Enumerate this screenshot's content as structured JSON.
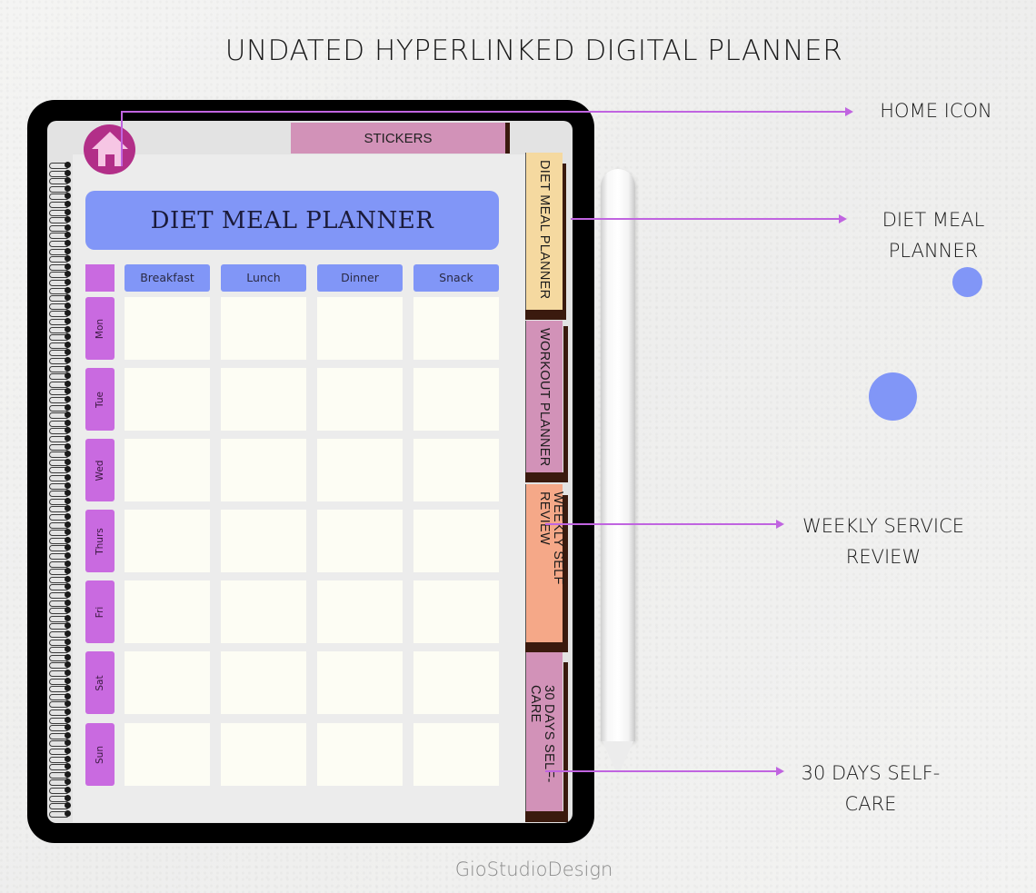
{
  "title": "UNDATED HYPERLINKED DIGITAL PLANNER",
  "brand": "GioStudioDesign",
  "colors": {
    "accent_blue": "#8196f7",
    "accent_purple": "#c96ae0",
    "home_magenta": "#b22f88",
    "callout_line": "#c064e0",
    "meal_cell": "#fdfdf4",
    "tab_diet": "#f5d9a0",
    "tab_workout": "#d292b8",
    "tab_weekly": "#f5a888",
    "tab_selfcare": "#d292b8"
  },
  "planner": {
    "home_icon": "home-icon",
    "stickers_label": "STICKERS",
    "heading": "DIET MEAL PLANNER",
    "columns": [
      "Breakfast",
      "Lunch",
      "Dinner",
      "Snack"
    ],
    "days": [
      "Mon",
      "Tue",
      "Wed",
      "Thurs",
      "Fri",
      "Sat",
      "Sun"
    ],
    "side_tabs": [
      {
        "label": "DIET MEAL PLANNER"
      },
      {
        "label": "WORKOUT PLANNER"
      },
      {
        "label": "WEEKLY SELF REVIEW"
      },
      {
        "label": "30 DAYS SELF-CARE"
      }
    ]
  },
  "callouts": [
    {
      "line1": "HOME ICON",
      "line2": ""
    },
    {
      "line1": "DIET MEAL",
      "line2": "PLANNER"
    },
    {
      "line1": "WEEKLY SERVICE",
      "line2": "REVIEW"
    },
    {
      "line1": "30 DAYS SELF-",
      "line2": "CARE"
    }
  ]
}
